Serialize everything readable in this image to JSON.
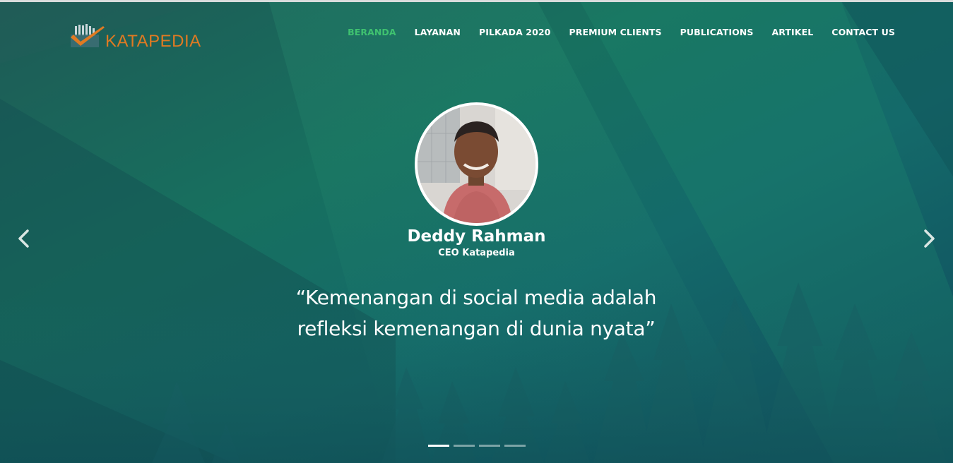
{
  "brand": {
    "name": "KATAPEDIA",
    "accent_color": "#e07a22",
    "logo_icon": "check-bars-logo-icon"
  },
  "nav": {
    "active_color": "#3fc270",
    "items": [
      {
        "label": "BERANDA",
        "active": true
      },
      {
        "label": "LAYANAN",
        "active": false
      },
      {
        "label": "PILKADA 2020",
        "active": false
      },
      {
        "label": "PREMIUM CLIENTS",
        "active": false
      },
      {
        "label": "PUBLICATIONS",
        "active": false
      },
      {
        "label": "ARTIKEL",
        "active": false
      },
      {
        "label": "CONTACT US",
        "active": false
      }
    ]
  },
  "testimonial": {
    "name": "Deddy Rahman",
    "role": "CEO Katapedia",
    "quote": "“Kemenangan di social media adalah refleksi kemenangan di dunia nyata”"
  },
  "carousel": {
    "prev_icon": "chevron-left-icon",
    "next_icon": "chevron-right-icon",
    "slide_count": 4,
    "active_index": 0
  }
}
